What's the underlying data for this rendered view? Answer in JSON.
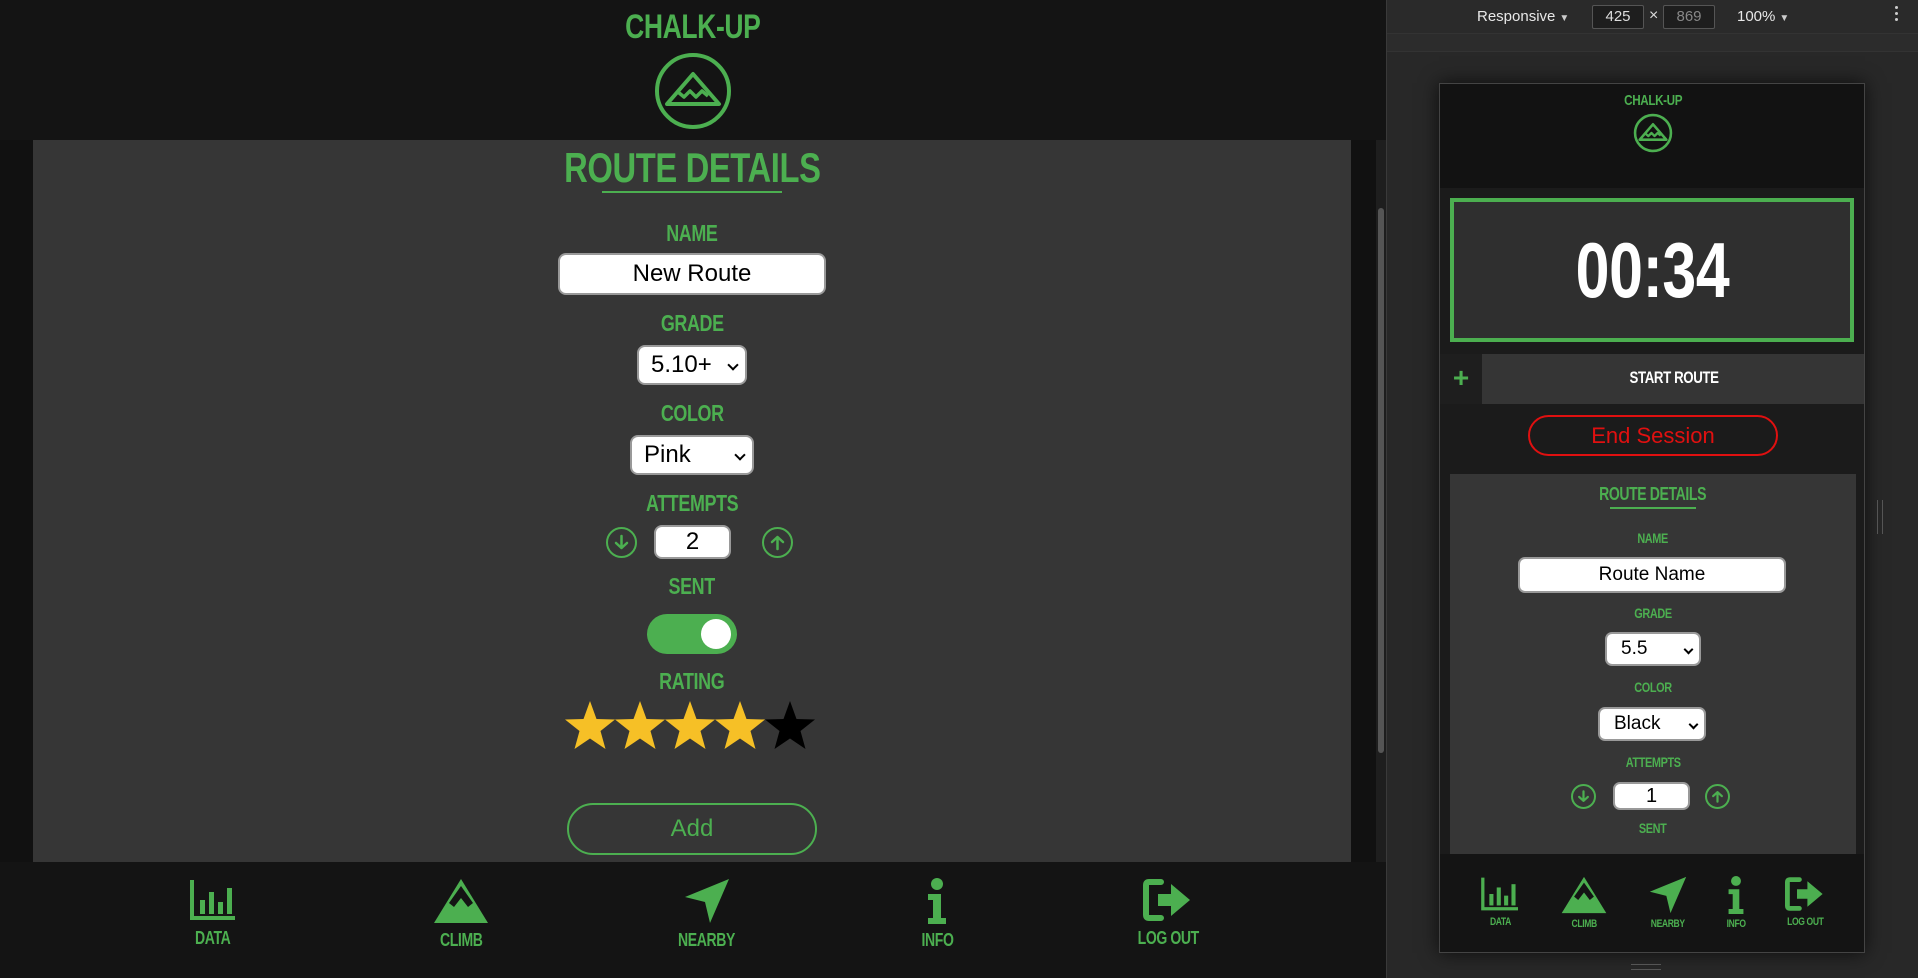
{
  "app": {
    "brand": "CHALK-UP",
    "route_details": {
      "title": "ROUTE DETAILS",
      "name_label": "NAME",
      "name_value": "New Route",
      "grade_label": "GRADE",
      "grade_value": "5.10+",
      "color_label": "COLOR",
      "color_value": "Pink",
      "attempts_label": "ATTEMPTS",
      "attempts_value": "2",
      "sent_label": "SENT",
      "sent_on": true,
      "rating_label": "RATING",
      "rating_value": 4,
      "rating_max": 5,
      "add_label": "Add"
    },
    "nav": [
      {
        "label": "DATA",
        "icon": "bar-chart-icon"
      },
      {
        "label": "CLIMB",
        "icon": "mountain-icon"
      },
      {
        "label": "NEARBY",
        "icon": "location-arrow-icon"
      },
      {
        "label": "INFO",
        "icon": "info-icon"
      },
      {
        "label": "LOG OUT",
        "icon": "sign-out-icon"
      }
    ],
    "colors": {
      "accent": "#4caf50",
      "panel": "#363636",
      "star": "#f6c026",
      "danger": "#e01010"
    }
  },
  "devtools": {
    "device_mode": "Responsive",
    "width": "425",
    "height": "869",
    "zoom": "100%"
  },
  "mobile": {
    "brand": "CHALK-UP",
    "timer": "00:34",
    "start_route_label": "START ROUTE",
    "plus_label": "+",
    "end_session_label": "End Session",
    "route_details": {
      "title": "ROUTE DETAILS",
      "name_label": "NAME",
      "name_placeholder": "Route Name",
      "grade_label": "GRADE",
      "grade_value": "5.5",
      "color_label": "COLOR",
      "color_value": "Black",
      "attempts_label": "ATTEMPTS",
      "attempts_value": "1",
      "sent_label": "SENT"
    },
    "nav": [
      {
        "label": "DATA",
        "icon": "bar-chart-icon"
      },
      {
        "label": "CLIMB",
        "icon": "mountain-icon"
      },
      {
        "label": "NEARBY",
        "icon": "location-arrow-icon"
      },
      {
        "label": "INFO",
        "icon": "info-icon"
      },
      {
        "label": "LOG OUT",
        "icon": "sign-out-icon"
      }
    ]
  }
}
